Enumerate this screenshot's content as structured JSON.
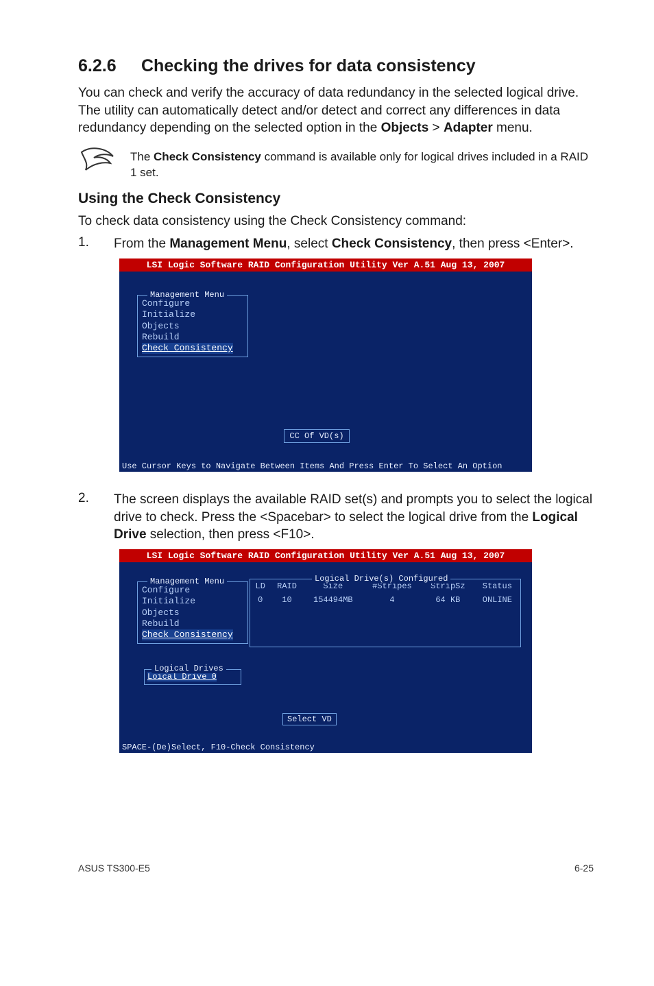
{
  "section": {
    "number": "6.2.6",
    "title": "Checking the drives for data consistency",
    "intro": "You can check and verify the accuracy of data redundancy in the selected logical drive. The utility can automatically detect and/or detect and correct any differences in data redundancy depending on the selected option in the ",
    "intro_bold1": "Objects",
    "intro_gt": " > ",
    "intro_bold2": "Adapter",
    "intro_after": " menu."
  },
  "note": {
    "pre": "The ",
    "bold": "Check Consistency",
    "post": " command is available only for logical drives included in a RAID 1 set."
  },
  "sub": {
    "title": "Using the Check Consistency",
    "lead": "To check data consistency using the Check Consistency command:"
  },
  "steps": {
    "s1_n": "1.",
    "s1_pre": "From the ",
    "s1_b1": "Management Menu",
    "s1_mid": ", select ",
    "s1_b2": "Check Consistency",
    "s1_post": ", then press <Enter>.",
    "s2_n": "2.",
    "s2_pre": "The screen displays the available RAID set(s) and prompts you to select the logical drive to check. Press the <Spacebar> to select the logical drive from the ",
    "s2_b1": "Logical Drive",
    "s2_post": " selection, then press <F10>."
  },
  "bios": {
    "title": "LSI Logic Software RAID Configuration Utility Ver A.51 Aug 13, 2007",
    "menu_title": "Management Menu",
    "items": [
      "Configure",
      "Initialize",
      "Objects",
      "Rebuild",
      "Check Consistency"
    ],
    "ccbox": "CC Of VD(s)",
    "hint1": "Use Cursor Keys to Navigate Between Items And Press Enter To Select An Option",
    "panel_title": "Logical Drive(s) Configured",
    "headers": [
      "LD",
      "RAID",
      "Size",
      "#Stripes",
      "StripSz",
      "Status"
    ],
    "row": [
      "0",
      "10",
      "154494MB",
      "4",
      "64 KB",
      "ONLINE"
    ],
    "drives_title": "Logical Drives",
    "drives_item": "Loical Drive 0",
    "selvd": "Select VD",
    "hint2": "SPACE-(De)Select, F10-Check Consistency"
  },
  "footer": {
    "left": "ASUS TS300-E5",
    "right": "6-25"
  }
}
